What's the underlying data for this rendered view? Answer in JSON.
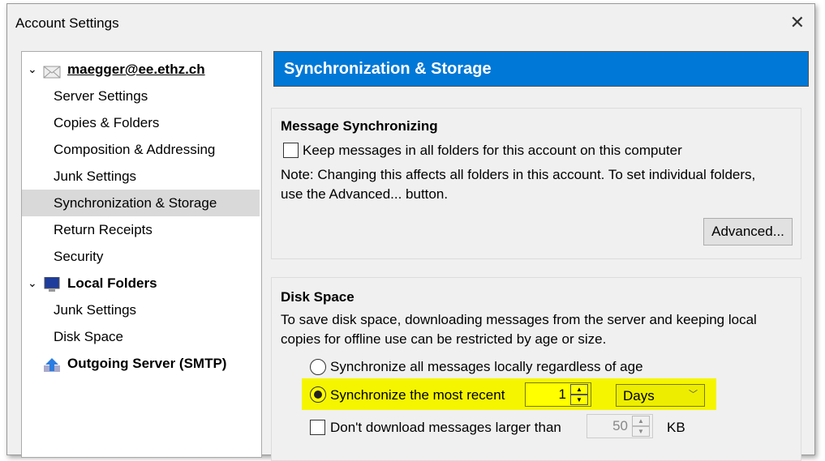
{
  "window": {
    "title": "Account Settings",
    "close_icon": "close-icon"
  },
  "tree": {
    "items": [
      {
        "label": "maegger@ee.ethz.ch",
        "type": "account",
        "icon": "envelope-icon"
      },
      {
        "label": "Server Settings"
      },
      {
        "label": "Copies & Folders"
      },
      {
        "label": "Composition & Addressing"
      },
      {
        "label": "Junk Settings"
      },
      {
        "label": "Synchronization & Storage",
        "selected": true
      },
      {
        "label": "Return Receipts"
      },
      {
        "label": "Security"
      },
      {
        "label": "Local Folders",
        "type": "account",
        "icon": "computer-icon"
      },
      {
        "label": "Junk Settings"
      },
      {
        "label": "Disk Space"
      },
      {
        "label": "Outgoing Server (SMTP)",
        "type": "account",
        "icon": "upload-server-icon"
      }
    ]
  },
  "header": {
    "title": "Synchronization & Storage",
    "color": "#0078d7"
  },
  "sync": {
    "title": "Message Synchronizing",
    "keep_label": "Keep messages in all folders for this account on this computer",
    "keep_checked": false,
    "note_line1": "Note: Changing this affects all folders in this account. To set individual folders,",
    "note_line2": "use the Advanced... button.",
    "advanced": "Advanced..."
  },
  "disk": {
    "title": "Disk Space",
    "desc_line1": "To save disk space, downloading messages from the server and keeping local",
    "desc_line2": "copies for offline use can be restricted by age or size.",
    "opt_all": "Synchronize all messages locally regardless of age",
    "opt_recent": "Synchronize the most recent",
    "recent_value": "1",
    "recent_unit": "Days",
    "size_label": "Don't download messages larger than",
    "size_value": "50",
    "size_unit": "KB",
    "highlight_color": "#ffff00"
  }
}
